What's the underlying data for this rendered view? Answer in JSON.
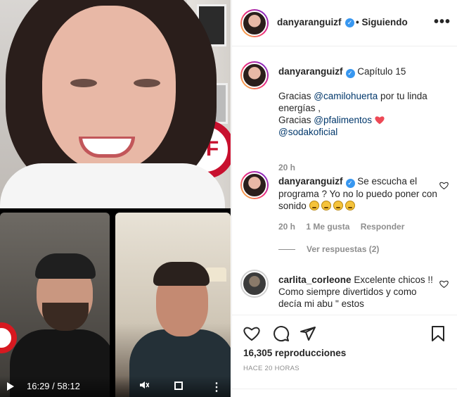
{
  "header": {
    "username": "danyaranguizf",
    "follow_status": "• Siguiendo",
    "more": "•••"
  },
  "video": {
    "time": "16:29 / 58:12",
    "pf_sign": "PF"
  },
  "comments": [
    {
      "username": "danyaranguizf",
      "title": "Capítulo 15",
      "lines": {
        "l1_pre": "Gracias ",
        "l1_mention": "@camilohuerta",
        "l1_post": " por tu linda energías ,",
        "l2_pre": "Gracias ",
        "l2_mention": "@pfalimentos",
        "l3_mention": "@sodakoficial"
      },
      "time": "20 h"
    },
    {
      "username": "danyaranguizf",
      "text": "Se escucha el programa ? Yo no lo puedo poner con sonido",
      "time": "20 h",
      "likes": "1 Me gusta",
      "reply": "Responder"
    },
    {
      "username": "carlita_corleone",
      "text": "Excelente chicos !! Como siempre divertidos y como decía mi abu \" estos"
    }
  ],
  "view_replies": "Ver respuestas (2)",
  "footer": {
    "views": "16,305 reproducciones",
    "ago": "HACE 20 HORAS"
  },
  "colors": {
    "mention": "#00376b",
    "verified": "#3897f0",
    "heart": "#ed4956"
  }
}
